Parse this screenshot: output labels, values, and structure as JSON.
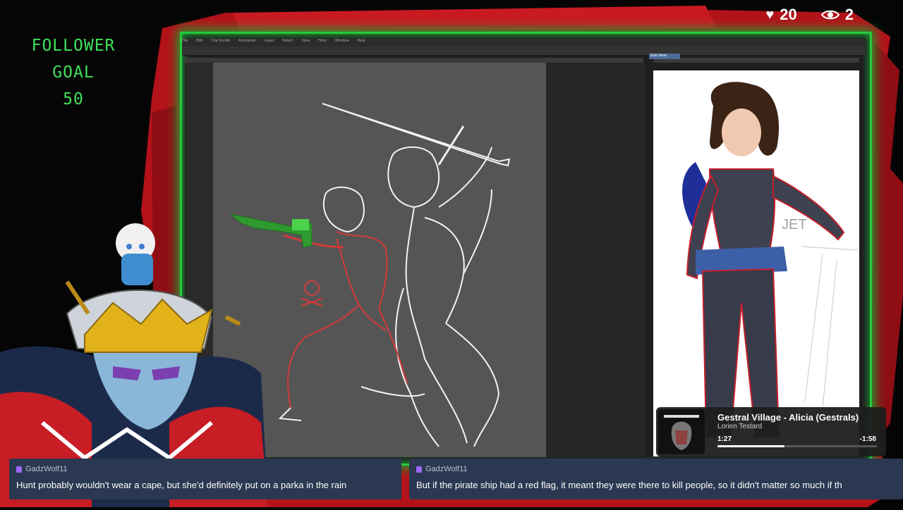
{
  "stats": {
    "likes": "20",
    "viewers": "2",
    "likes_icon": "heart-icon",
    "viewers_icon": "eye-icon"
  },
  "goal": {
    "line1": "FOLLOWER",
    "line2": "GOAL",
    "line3": "50"
  },
  "app": {
    "menu": [
      "File",
      "Edit",
      "Clip Studio",
      "Animation",
      "Layer",
      "Select",
      "View",
      "Filter",
      "Window",
      "Help"
    ],
    "ref_tab": "Sub View"
  },
  "reference_text": "JET",
  "music": {
    "title": "Gestral Village - Alicia (Gestrals)",
    "artist": "Lorien Testard",
    "elapsed": "1:27",
    "remaining": "-1:58",
    "progress": 0.42
  },
  "chat": [
    {
      "user": "GadzWolf11",
      "message": "Hunt probably wouldn't wear a cape, but she'd definitely put on a parka in the rain"
    },
    {
      "user": "GadzWolf11",
      "message": "But if the pirate ship had a red flag, it meant they were there to kill people, so it didn't matter so much if th"
    }
  ],
  "colors": {
    "frame": "#27c93f",
    "goal": "#40e05a",
    "chat_bg": "#2a3851",
    "backdrop_red": "#b3121a"
  }
}
